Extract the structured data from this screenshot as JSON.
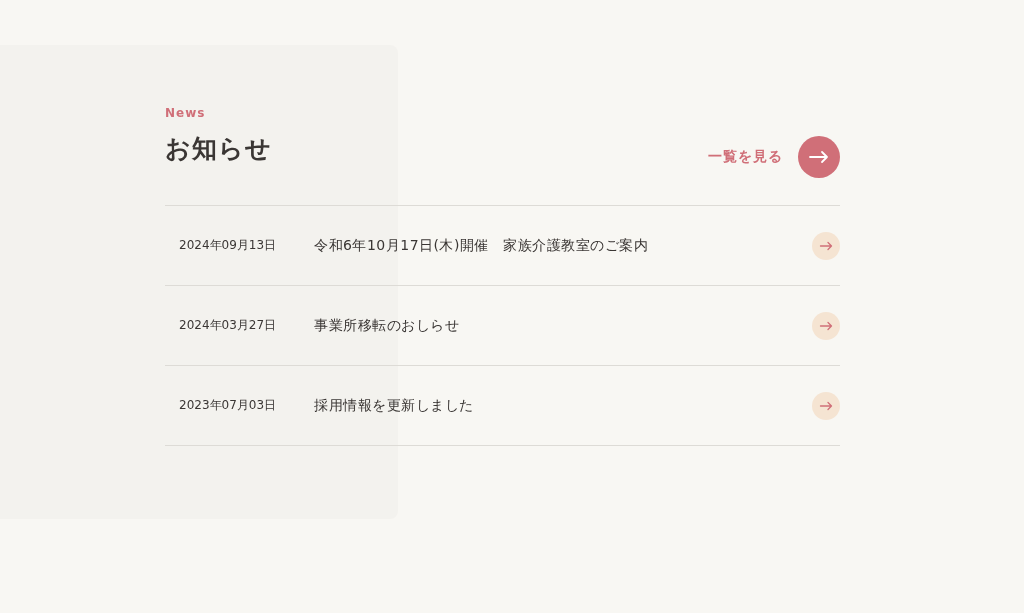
{
  "section": {
    "eyebrow": "News",
    "title": "お知らせ",
    "more_link": "一覧を見る"
  },
  "news": [
    {
      "date": "2024年09月13日",
      "title": "令和6年10月17日(木)開催　家族介護教室のご案内"
    },
    {
      "date": "2024年03月27日",
      "title": "事業所移転のおしらせ"
    },
    {
      "date": "2023年07月03日",
      "title": "採用情報を更新しました"
    }
  ]
}
